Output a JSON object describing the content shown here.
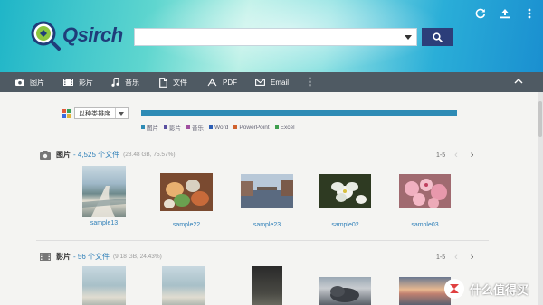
{
  "app": {
    "name": "Qsirch"
  },
  "search": {
    "value": "",
    "placeholder": ""
  },
  "tabs": [
    {
      "label": "图片",
      "icon": "camera-icon"
    },
    {
      "label": "影片",
      "icon": "film-icon"
    },
    {
      "label": "音乐",
      "icon": "music-icon"
    },
    {
      "label": "文件",
      "icon": "document-icon"
    },
    {
      "label": "PDF",
      "icon": "pdf-icon"
    },
    {
      "label": "Email",
      "icon": "email-icon"
    }
  ],
  "filter": {
    "sort_label": "以种类排序"
  },
  "legend": [
    {
      "label": "图片",
      "color": "#2e8bb5"
    },
    {
      "label": "影片",
      "color": "#5a4fa0"
    },
    {
      "label": "音乐",
      "color": "#a04fa0"
    },
    {
      "label": "Word",
      "color": "#2e5fb5"
    },
    {
      "label": "PowerPoint",
      "color": "#d0622e"
    },
    {
      "label": "Excel",
      "color": "#3e9e4e"
    }
  ],
  "sections": {
    "photos": {
      "category": "图片",
      "count_text": "- 4,525 个文件",
      "size_text": "(28.48 GB, 75.57%)",
      "pager": "1-5",
      "items": [
        {
          "label": "sample13"
        },
        {
          "label": "sample22"
        },
        {
          "label": "sample23"
        },
        {
          "label": "sample02"
        },
        {
          "label": "sample03"
        }
      ]
    },
    "videos": {
      "category": "影片",
      "count_text": "- 56 个文件",
      "size_text": "(9.18 GB, 24.43%)",
      "pager": "1-5"
    }
  },
  "watermark": {
    "text": "什么值得买"
  }
}
